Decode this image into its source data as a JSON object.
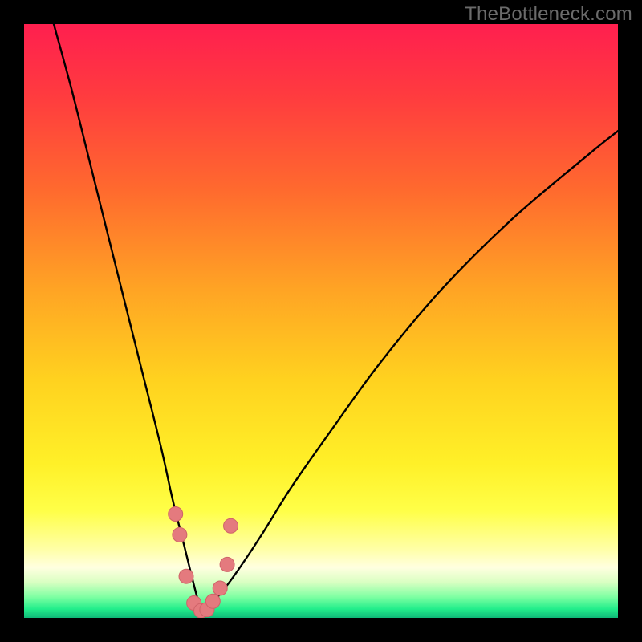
{
  "watermark": {
    "text": "TheBottleneck.com"
  },
  "colors": {
    "black": "#000000",
    "curve": "#000000",
    "marker_fill": "#e47a7e",
    "marker_stroke": "#cf6368",
    "gradient_stops": [
      {
        "offset": 0.0,
        "color": "#ff1f4f"
      },
      {
        "offset": 0.12,
        "color": "#ff3b3f"
      },
      {
        "offset": 0.28,
        "color": "#ff6a2e"
      },
      {
        "offset": 0.45,
        "color": "#ffa524"
      },
      {
        "offset": 0.6,
        "color": "#ffd21f"
      },
      {
        "offset": 0.74,
        "color": "#fff028"
      },
      {
        "offset": 0.82,
        "color": "#ffff48"
      },
      {
        "offset": 0.885,
        "color": "#ffffa8"
      },
      {
        "offset": 0.915,
        "color": "#ffffe0"
      },
      {
        "offset": 0.94,
        "color": "#d9ffc2"
      },
      {
        "offset": 0.965,
        "color": "#7dffa2"
      },
      {
        "offset": 0.985,
        "color": "#22ee8b"
      },
      {
        "offset": 1.0,
        "color": "#0fb978"
      }
    ]
  },
  "chart_data": {
    "type": "line",
    "title": "",
    "xlabel": "",
    "ylabel": "",
    "xlim": [
      0,
      100
    ],
    "ylim": [
      0,
      100
    ],
    "x_at_minimum": 30,
    "series": [
      {
        "name": "bottleneck-curve",
        "x": [
          5,
          8,
          11,
          14,
          17,
          20,
          23,
          25,
          27,
          29,
          30,
          31,
          33,
          36,
          40,
          45,
          52,
          60,
          70,
          82,
          95,
          100
        ],
        "y": [
          100,
          89,
          77,
          65,
          53,
          41,
          29,
          20,
          12,
          4,
          1,
          2,
          4,
          8,
          14,
          22,
          32,
          43,
          55,
          67,
          78,
          82
        ]
      }
    ],
    "markers": {
      "name": "highlight-points",
      "x": [
        25.5,
        26.2,
        27.3,
        28.6,
        29.8,
        30.8,
        31.8,
        33.0,
        34.2,
        34.8
      ],
      "y": [
        17.5,
        14.0,
        7.0,
        2.5,
        1.2,
        1.4,
        2.8,
        5.0,
        9.0,
        15.5
      ]
    }
  }
}
